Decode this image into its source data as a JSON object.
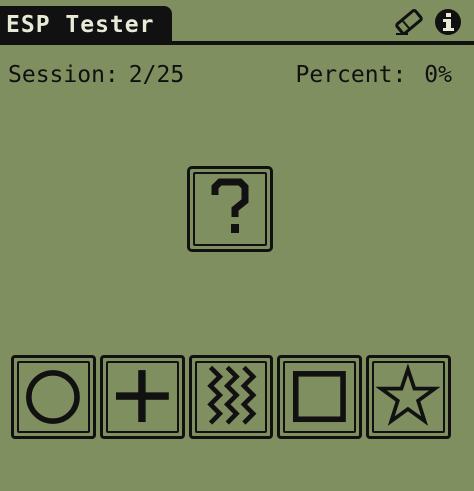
{
  "app": {
    "title": "ESP Tester"
  },
  "toolbar": {
    "icons": [
      "eraser-icon",
      "info-icon"
    ]
  },
  "stats": {
    "session_label": "Session:",
    "session_value": "2/25",
    "percent_label": "Percent:",
    "percent_value": "0%"
  },
  "prompt": {
    "symbol": "?"
  },
  "cards": [
    {
      "name": "circle-card",
      "icon": "circle-icon"
    },
    {
      "name": "plus-card",
      "icon": "plus-icon"
    },
    {
      "name": "waves-card",
      "icon": "waves-icon"
    },
    {
      "name": "square-card",
      "icon": "square-icon"
    },
    {
      "name": "star-card",
      "icon": "star-icon"
    }
  ],
  "colors": {
    "background": "#7f8f60",
    "ink": "#111111",
    "title_text": "#e9e9d8"
  }
}
